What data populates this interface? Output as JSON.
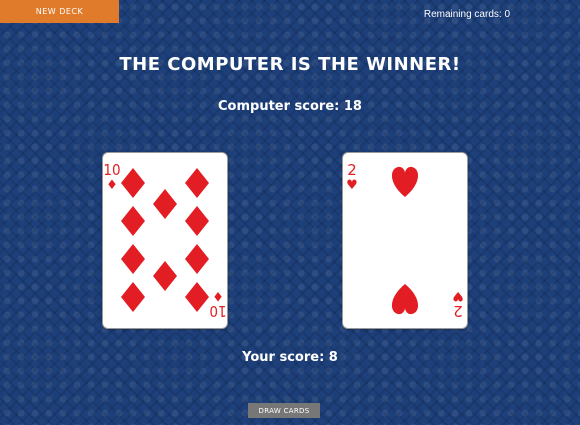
{
  "header": {
    "new_deck_label": "NEW DECK",
    "remaining_label": "Remaining cards:",
    "remaining_count": "0"
  },
  "game": {
    "result": "THE COMPUTER IS THE WINNER!",
    "computer_score_text": "Computer score: 18",
    "player_score_text": "Your score: 8",
    "draw_cards_label": "DRAW CARDS"
  },
  "cards": [
    {
      "owner": "computer",
      "rank": "10",
      "suit": "diamonds",
      "suit_symbol": "♦",
      "color": "#e21d24"
    },
    {
      "owner": "player",
      "rank": "2",
      "suit": "hearts",
      "suit_symbol": "♥",
      "color": "#e21d24"
    }
  ],
  "colors": {
    "background": "#1d3f7a",
    "accent_orange": "#e07b2b",
    "button_gray": "#777777",
    "card_red": "#e21d24"
  }
}
